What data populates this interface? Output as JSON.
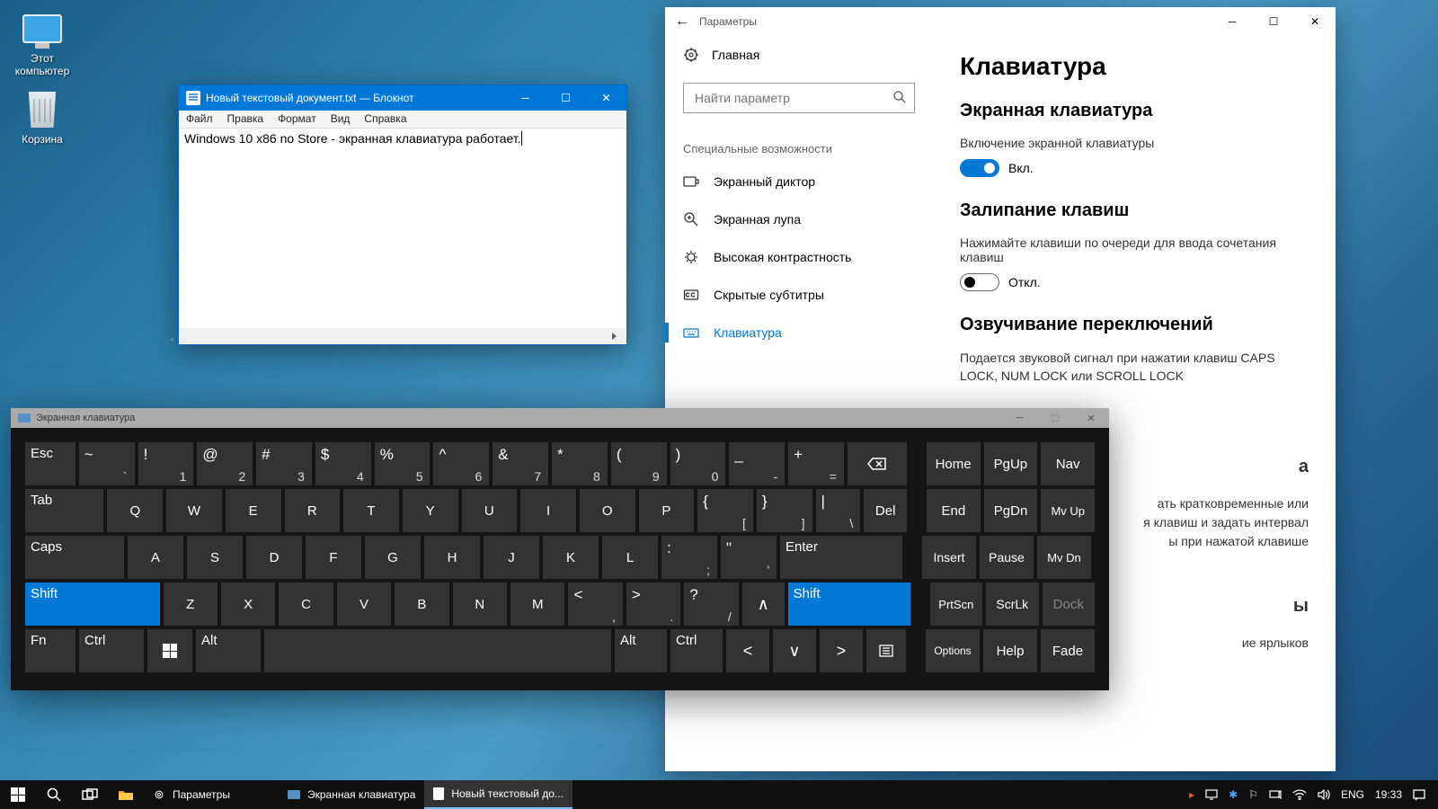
{
  "desktop": {
    "this_pc": "Этот\nкомпьютер",
    "recycle_bin": "Корзина"
  },
  "notepad": {
    "title": "Новый текстовый документ.txt — Блокнот",
    "menu": {
      "file": "Файл",
      "edit": "Правка",
      "format": "Формат",
      "view": "Вид",
      "help": "Справка"
    },
    "content": "Windows 10 x86 no Store - экранная клавиатура работает."
  },
  "settings": {
    "title": "Параметры",
    "home": "Главная",
    "search_ph": "Найти параметр",
    "section": "Специальные возможности",
    "nav": {
      "narrator": "Экранный диктор",
      "magnifier": "Экранная лупа",
      "contrast": "Высокая контрастность",
      "captions": "Скрытые субтитры",
      "keyboard": "Клавиатура"
    },
    "h1": "Клавиатура",
    "h2a": "Экранная клавиатура",
    "l1": "Включение экранной клавиатуры",
    "on": "Вкл.",
    "h2b": "Залипание клавиш",
    "l2": "Нажимайте клавиши по очереди для ввода сочетания клавиш",
    "off": "Откл.",
    "h2c": "Озвучивание переключений",
    "t1": "Подается звуковой сигнал при нажатии клавиш CAPS LOCK, NUM LOCK или SCROLL LOCK",
    "h2d": "а",
    "r1": "ать кратковременные или",
    "r2": "я клавиш и задать интервал",
    "r3": "ы при нажатой клавише",
    "h2e": "ы",
    "r4": "ие ярлыков"
  },
  "osk": {
    "title": "Экранная клавиатура",
    "keys": {
      "esc": "Esc",
      "tab": "Tab",
      "caps": "Caps",
      "shift": "Shift",
      "fn": "Fn",
      "ctrl": "Ctrl",
      "alt": "Alt",
      "enter": "Enter",
      "del": "Del",
      "home": "Home",
      "pgup": "PgUp",
      "nav": "Nav",
      "end": "End",
      "pgdn": "PgDn",
      "mvup": "Mv Up",
      "insert": "Insert",
      "pause": "Pause",
      "mvdn": "Mv Dn",
      "prtscn": "PrtScn",
      "scrlk": "ScrLk",
      "dock": "Dock",
      "options": "Options",
      "help": "Help",
      "fade": "Fade"
    }
  },
  "taskbar": {
    "apps": {
      "params": "Параметры",
      "osk": "Экранная клавиатура",
      "notepad": "Новый текстовый до..."
    },
    "lang": "ENG",
    "time": "19:33"
  }
}
